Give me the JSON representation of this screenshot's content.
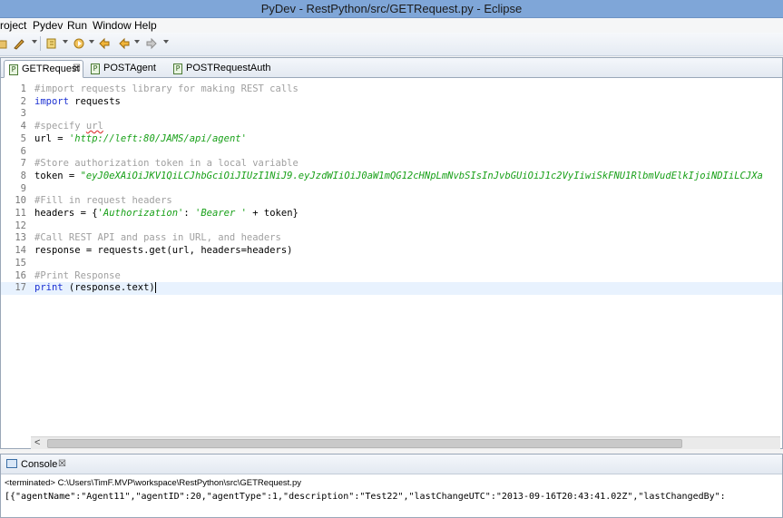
{
  "window": {
    "title": "PyDev - RestPython/src/GETRequest.py - Eclipse"
  },
  "menu": {
    "items": [
      "roject",
      "Pydev",
      "Run",
      "Window",
      "Help"
    ]
  },
  "toolbar": {
    "icons": [
      "open-icon",
      "edit-icon",
      "tool-icon",
      "run-icon",
      "back-icon",
      "forward-back-icon",
      "forward-icon"
    ]
  },
  "editor": {
    "tabs": [
      {
        "label": "GETRequest",
        "close": "☒",
        "active": true
      },
      {
        "label": "POSTAgent",
        "active": false
      },
      {
        "label": "POSTRequestAuth",
        "active": false
      }
    ],
    "lines": [
      {
        "n": "1",
        "segs": [
          {
            "t": "#import requests library for making REST calls",
            "c": "comment"
          }
        ]
      },
      {
        "n": "2",
        "segs": [
          {
            "t": "import",
            "c": "kw"
          },
          {
            "t": " requests",
            "c": ""
          }
        ]
      },
      {
        "n": "3",
        "segs": []
      },
      {
        "n": "4",
        "segs": [
          {
            "t": "#specify ",
            "c": "comment"
          },
          {
            "t": "url",
            "c": "comment under"
          }
        ]
      },
      {
        "n": "5",
        "segs": [
          {
            "t": "url = ",
            "c": ""
          },
          {
            "t": "'http://left:80/JAMS/api/agent'",
            "c": "str"
          }
        ]
      },
      {
        "n": "6",
        "segs": []
      },
      {
        "n": "7",
        "segs": [
          {
            "t": "#Store authorization token in a local variable",
            "c": "comment"
          }
        ]
      },
      {
        "n": "8",
        "segs": [
          {
            "t": "token = ",
            "c": ""
          },
          {
            "t": "\"eyJ0eXAiOiJKV1QiLCJhbGciOiJIUzI1NiJ9.eyJzdWIiOiJ0aW1mQG12cHNpLmNvbSIsInJvbGUiOiJ1c2VyIiwiSkFNU1RlbmVudElkIjoiNDIiLCJXa",
            "c": "str"
          }
        ]
      },
      {
        "n": "9",
        "segs": []
      },
      {
        "n": "10",
        "segs": [
          {
            "t": "#Fill in request headers",
            "c": "comment"
          }
        ]
      },
      {
        "n": "11",
        "segs": [
          {
            "t": "headers = {",
            "c": ""
          },
          {
            "t": "'Authorization'",
            "c": "str"
          },
          {
            "t": ": ",
            "c": ""
          },
          {
            "t": "'Bearer '",
            "c": "str"
          },
          {
            "t": " + token}",
            "c": ""
          }
        ]
      },
      {
        "n": "12",
        "segs": []
      },
      {
        "n": "13",
        "segs": [
          {
            "t": "#Call REST API and pass in URL, and headers",
            "c": "comment"
          }
        ]
      },
      {
        "n": "14",
        "segs": [
          {
            "t": "response = requests.get(url, headers=headers)",
            "c": ""
          }
        ]
      },
      {
        "n": "15",
        "segs": []
      },
      {
        "n": "16",
        "segs": [
          {
            "t": "#Print Response",
            "c": "comment"
          }
        ]
      },
      {
        "n": "17",
        "segs": [
          {
            "t": "print",
            "c": "kw"
          },
          {
            "t": " (response.text)",
            "c": ""
          }
        ],
        "current": true
      }
    ],
    "hscroll_left": "<"
  },
  "console": {
    "tab_label": "Console",
    "tab_close": "☒",
    "status": "<terminated> C:\\Users\\TimF.MVP\\workspace\\RestPython\\src\\GETRequest.py",
    "output": "[{\"agentName\":\"Agent11\",\"agentID\":20,\"agentType\":1,\"description\":\"Test22\",\"lastChangeUTC\":\"2013-09-16T20:43:41.02Z\",\"lastChangedBy\":"
  },
  "colors": {
    "title_bar": "#7fa6d8",
    "keyword": "#1a2fd2",
    "string": "#18a018",
    "comment": "#a0a0a0",
    "current_line": "#e8f2fe"
  }
}
